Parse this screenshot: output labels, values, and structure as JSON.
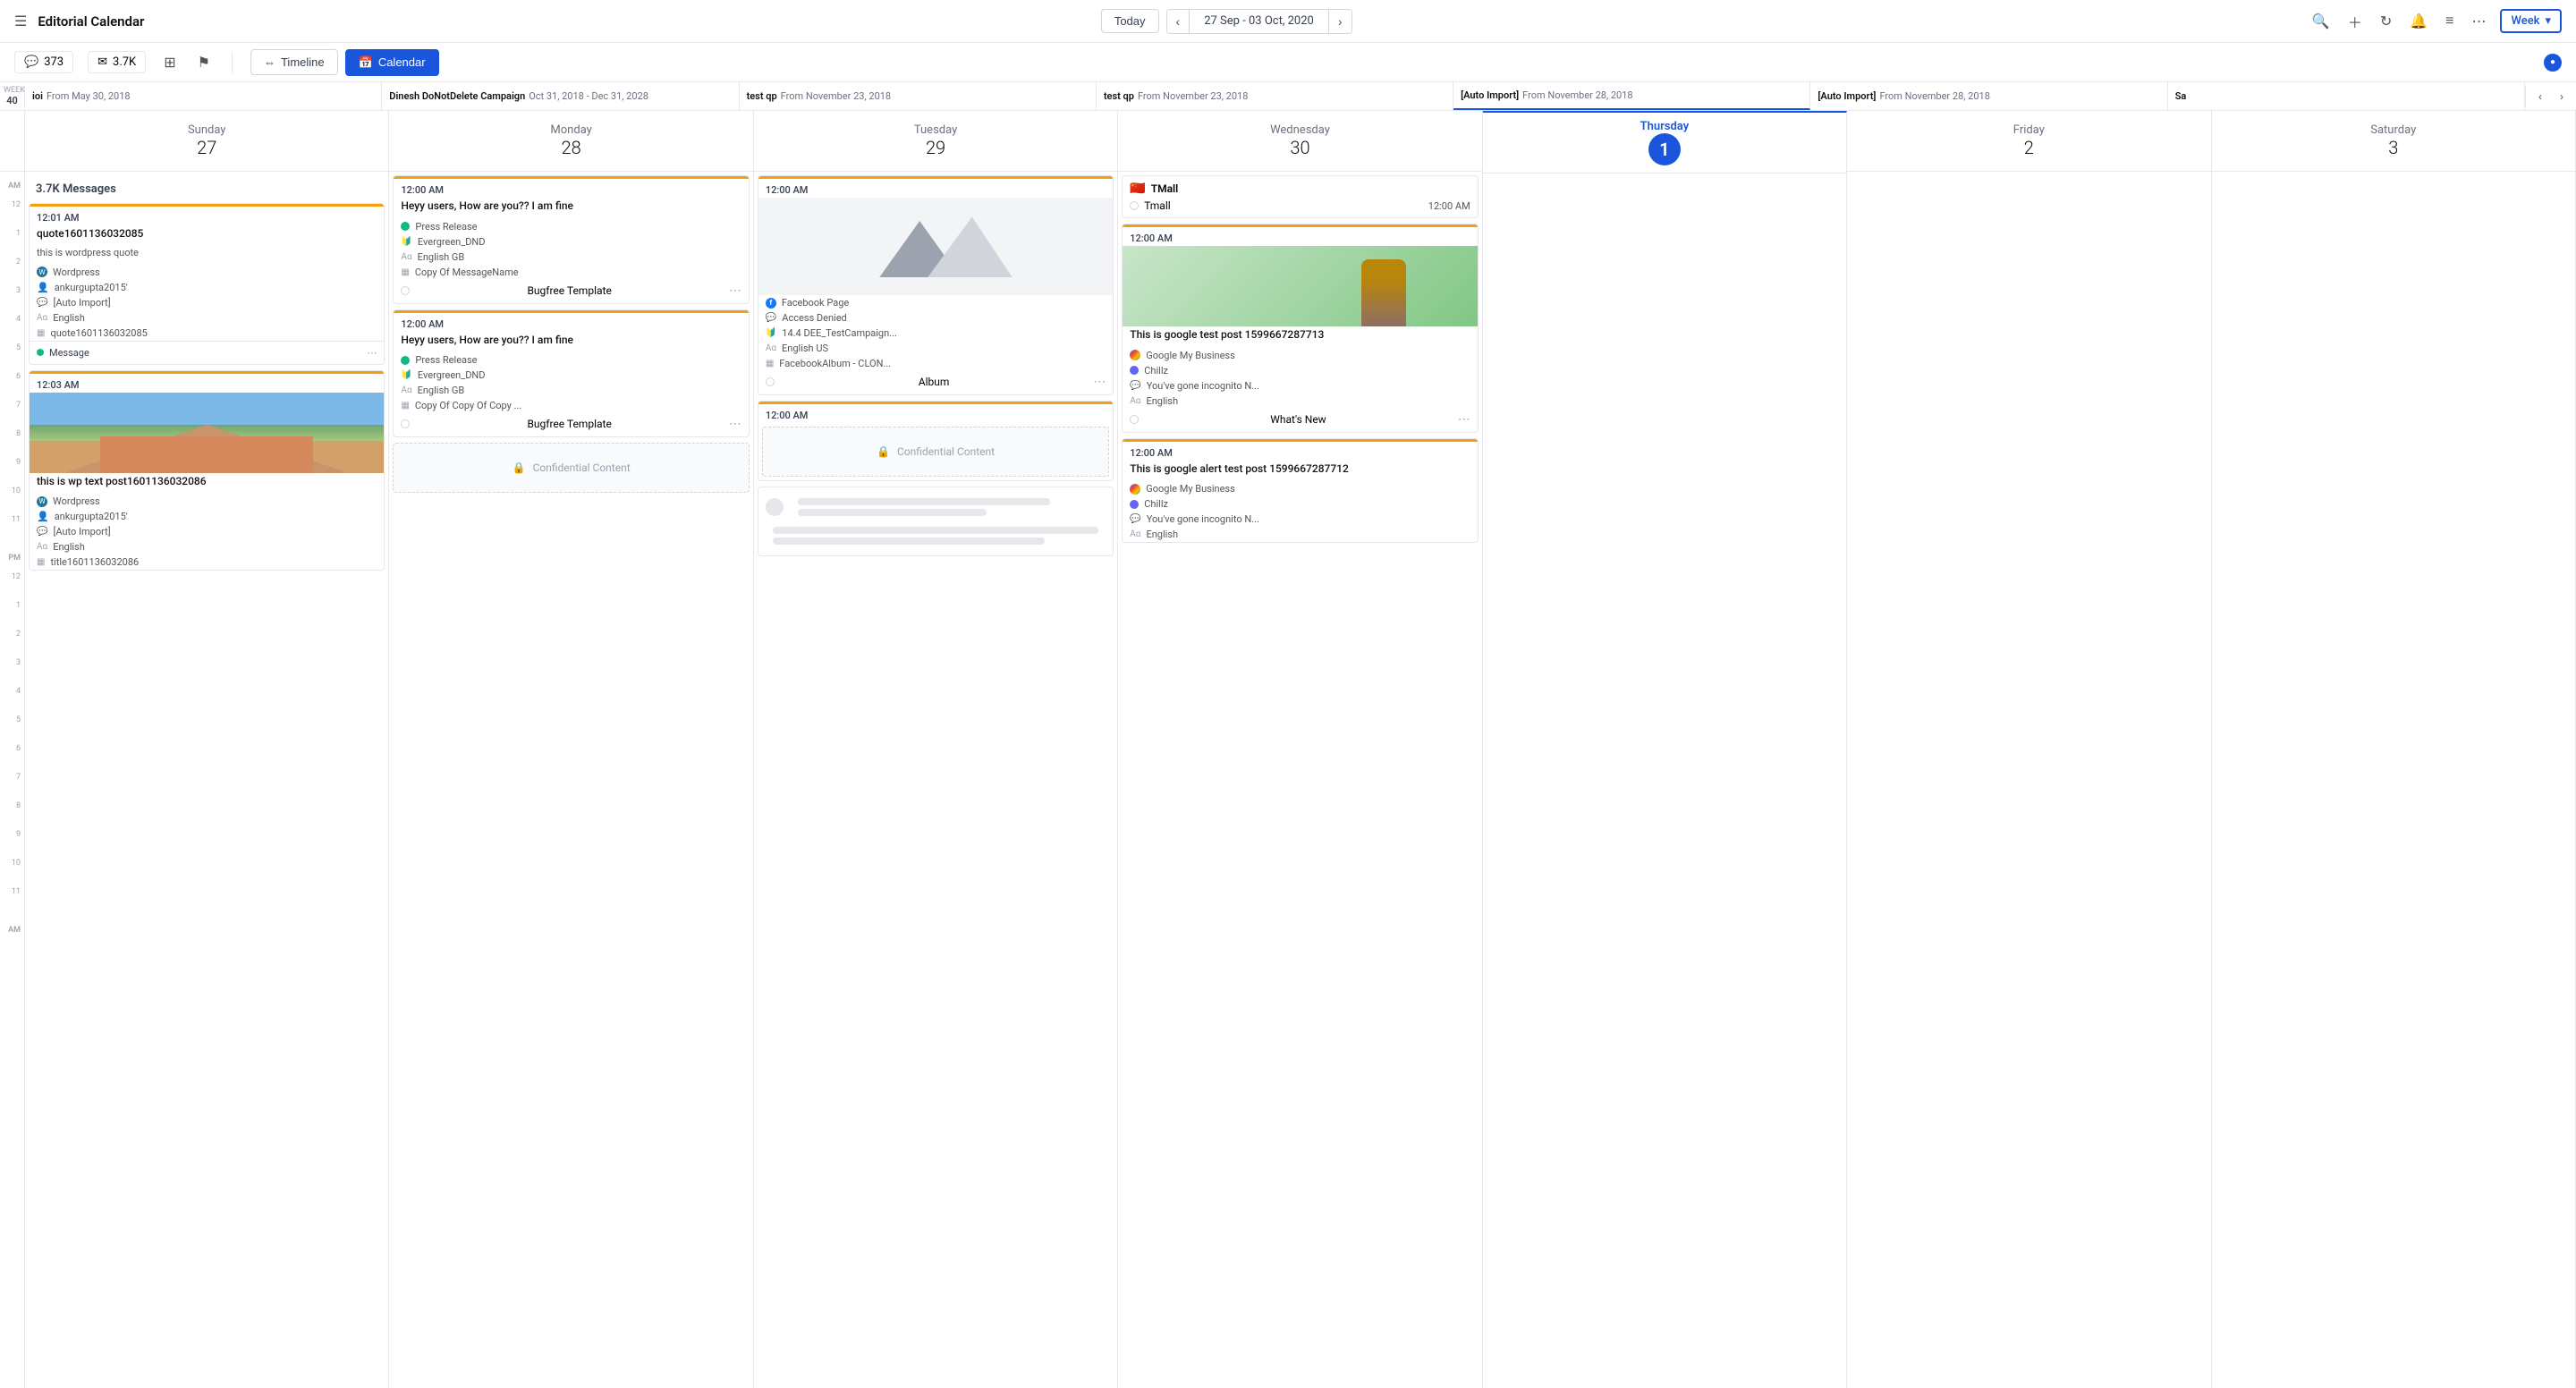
{
  "app": {
    "title": "Editorial Calendar"
  },
  "topnav": {
    "today_label": "Today",
    "date_range": "27 Sep - 03 Oct, 2020",
    "week_label": "Week",
    "prev_arrow": "‹",
    "next_arrow": "›"
  },
  "toolbar": {
    "badge_373": "373",
    "badge_37k": "3.7K",
    "timeline_label": "Timeline",
    "calendar_label": "Calendar"
  },
  "week_info": {
    "week_num": "40",
    "week_label": "WEEK"
  },
  "days": [
    {
      "name": "Sunday",
      "num": "27",
      "short": "Sunday 27",
      "today": false
    },
    {
      "name": "Monday",
      "num": "28",
      "short": "Monday 28",
      "today": false
    },
    {
      "name": "Tuesday",
      "num": "29",
      "short": "Tuesday 29",
      "today": false
    },
    {
      "name": "Wednesday",
      "num": "30",
      "short": "Wednesday 30",
      "today": false
    },
    {
      "name": "Thursday",
      "num": "1",
      "short": "Thursday 1",
      "today": true
    },
    {
      "name": "Friday",
      "num": "2",
      "short": "Friday 2",
      "today": false
    },
    {
      "name": "Saturday",
      "num": "3",
      "short": "Saturday 3",
      "today": false
    }
  ],
  "campaigns": [
    {
      "name": "ioi",
      "range": "From May 30, 2018"
    },
    {
      "name": "Dinesh DoNotDelete Campaign",
      "range": "Oct 31, 2018 - Dec 31, 2028"
    },
    {
      "name": "test qp",
      "range": "From November 23, 2018"
    },
    {
      "name": "test qp",
      "range": "From November 23, 2018"
    },
    {
      "name": "[Auto Import]",
      "range": "From November 28, 2018"
    },
    {
      "name": "[Auto Import]",
      "range": "From November 28, 2018"
    },
    {
      "name": "Sa",
      "range": ""
    }
  ],
  "messages_summary": "3.7K Messages",
  "sunday_cards": [
    {
      "time": "12:01 AM",
      "title": "quote1601136032085",
      "subtitle": "this is wordpress quote",
      "platform": "Wordpress",
      "user": "ankurgupta2015'",
      "source": "[Auto Import]",
      "lang": "English",
      "id": "quote1601136032085",
      "status": "Message"
    },
    {
      "time": "12:03 AM",
      "title": "this is wp text post1601136032086",
      "platform": "Wordpress",
      "user": "ankurgupta2015'",
      "source": "[Auto Import]",
      "lang": "English",
      "id": "title1601136032086"
    }
  ],
  "monday_cards": [
    {
      "time": "12:00 AM",
      "title": "Heyy users, How are you?? I am fine",
      "platform": "Press Release",
      "campaign": "Evergreen_DND",
      "lang": "English GB",
      "copy": "Copy Of MessageName",
      "template": "Bugfree Template"
    },
    {
      "time": "12:00 AM",
      "title": "Heyy users, How are you?? I am fine",
      "platform": "Press Release",
      "campaign": "Evergreen_DND",
      "lang": "English GB",
      "copy": "Copy Of Copy Of Copy ...",
      "template": "Bugfree Template"
    },
    {
      "confidential": true
    }
  ],
  "tuesday_cards": [
    {
      "time": "12:00 AM",
      "has_image": true,
      "platform": "Facebook Page",
      "title2": "Access Denied",
      "campaign": "14.4 DEE_TestCampaign...",
      "lang": "English US",
      "copy": "FacebookAlbum - CLON...",
      "status": "Album"
    },
    {
      "time": "12:00 AM",
      "confidential": true
    },
    {
      "skeleton": true
    }
  ],
  "wednesday_cards": [
    {
      "platform_icon": "tmall",
      "platform": "TMall",
      "time": "12:00 AM",
      "title": "Tmall"
    },
    {
      "time": "12:00 AM",
      "title": "This is google test post 1599667287713",
      "platform": "Google My Business",
      "campaign": "Chillz",
      "source": "You've gone incognito N...",
      "lang": "English",
      "status": "What's New",
      "has_person_image": true
    },
    {
      "time": "12:00 AM",
      "title": "This is google alert test post 1599667287712",
      "platform": "Google My Business",
      "campaign": "Chillz",
      "source": "You've gone incognito N...",
      "lang": "English"
    }
  ],
  "hours": [
    "AM",
    "12",
    "1",
    "2",
    "3",
    "4",
    "5",
    "6",
    "7",
    "8",
    "9",
    "10",
    "11",
    "PM",
    "12",
    "1",
    "2",
    "3",
    "4",
    "5",
    "6",
    "7",
    "8",
    "9",
    "10",
    "11",
    "AM"
  ]
}
